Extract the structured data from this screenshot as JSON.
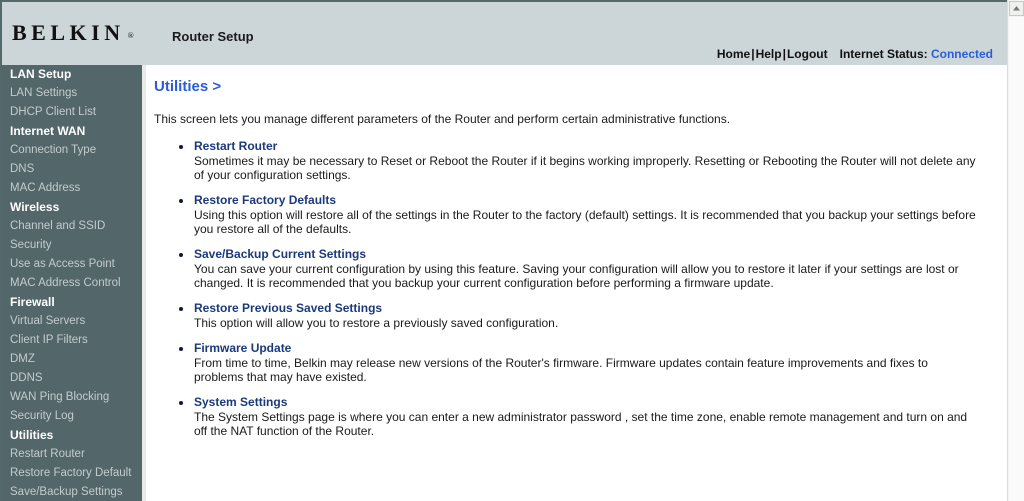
{
  "header": {
    "logo_text": "BELKIN",
    "logo_tm": "®",
    "title": "Router Setup",
    "nav": {
      "home": "Home",
      "help": "Help",
      "logout": "Logout",
      "separator": "|",
      "status_label": "Internet Status:",
      "status_value": "Connected",
      "status_color": "#2a5ddb"
    }
  },
  "sidebar": {
    "groups": [
      {
        "title": "LAN Setup",
        "items": [
          "LAN Settings",
          "DHCP Client List"
        ]
      },
      {
        "title": "Internet WAN",
        "items": [
          "Connection Type",
          "DNS",
          "MAC Address"
        ]
      },
      {
        "title": "Wireless",
        "items": [
          "Channel and SSID",
          "Security",
          "Use as Access Point",
          "MAC Address Control"
        ]
      },
      {
        "title": "Firewall",
        "items": [
          "Virtual Servers",
          "Client IP Filters",
          "DMZ",
          "DDNS",
          "WAN Ping Blocking",
          "Security Log"
        ]
      },
      {
        "title": "Utilities",
        "items": [
          "Restart Router",
          "Restore Factory Default",
          "Save/Backup Settings"
        ]
      }
    ]
  },
  "main": {
    "page_title": "Utilities",
    "page_title_arrow": ">",
    "intro": "This screen lets you manage different parameters of the Router and perform certain administrative functions.",
    "bullets": [
      {
        "heading": "Restart Router",
        "body": "Sometimes it may be necessary to Reset or Reboot the Router if it begins working improperly. Resetting or Rebooting the Router will not delete any of your configuration settings."
      },
      {
        "heading": "Restore Factory Defaults",
        "body": "Using this option will restore all of the settings in the Router to the factory (default) settings. It is recommended that you backup your settings before you restore all of the defaults."
      },
      {
        "heading": "Save/Backup Current Settings",
        "body": "You can save your current configuration by using this feature. Saving your configuration will allow you to restore it later if your settings are lost or changed. It is recommended that you backup your current configuration before performing a firmware update."
      },
      {
        "heading": "Restore Previous Saved Settings",
        "body": "This option will allow you to restore a previously saved configuration."
      },
      {
        "heading": "Firmware Update",
        "body": "From time to time, Belkin may release new versions of the Router's firmware. Firmware updates contain feature improvements and fixes to problems that may have existed."
      },
      {
        "heading": "System Settings",
        "body": "The System Settings page is where you can enter a new administrator password , set the time zone, enable remote management and turn on and off the NAT function of the Router."
      }
    ]
  },
  "scrollbar": {
    "up_arrow_icon": "chevron-up-icon"
  },
  "colors": {
    "header_bg": "#ccd6d9",
    "sidebar_bg": "#53666a",
    "accent_blue": "#2a5ddb",
    "heading_navy": "#1b3a7a"
  }
}
